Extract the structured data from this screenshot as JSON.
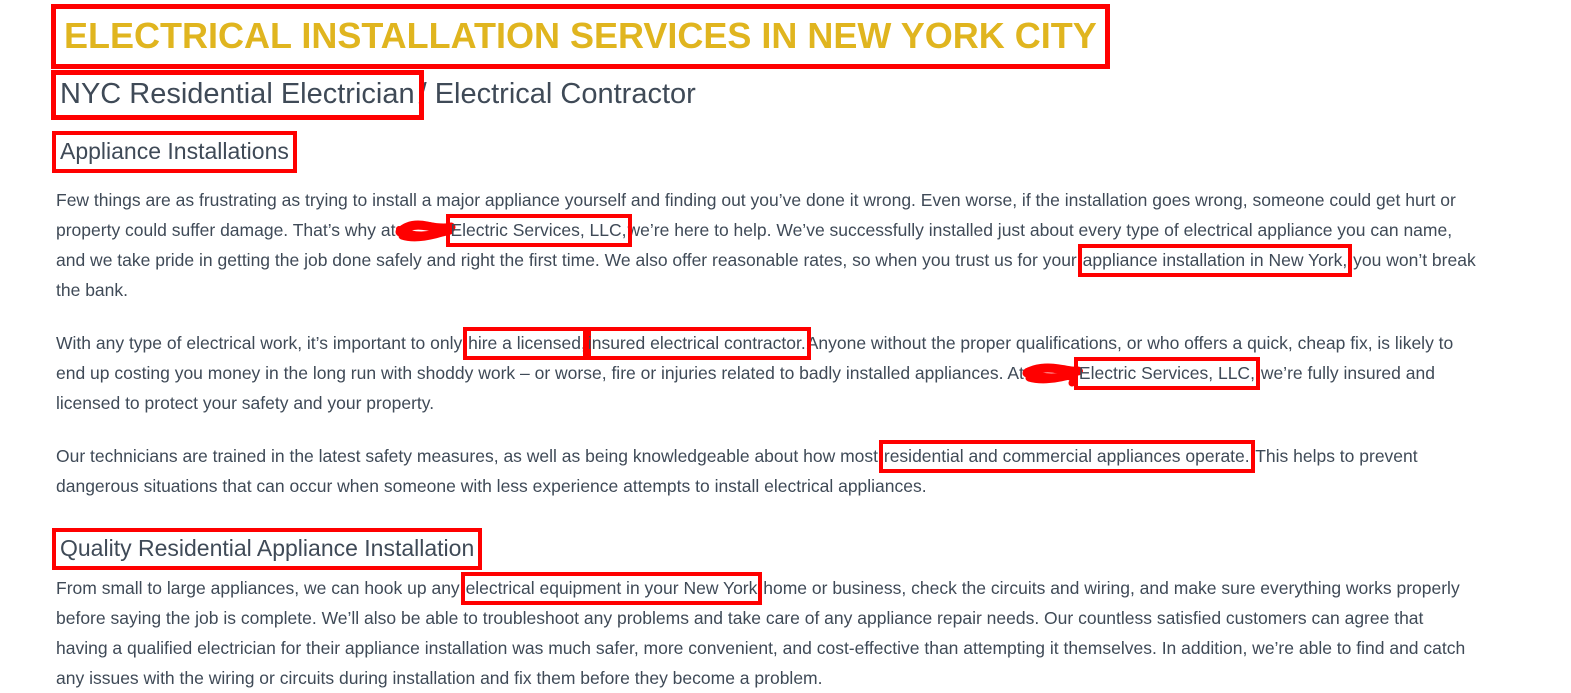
{
  "document": {
    "title": "ELECTRICAL INSTALLATION SERVICES IN NEW YORK CITY",
    "subtitle_highlighted": "NYC Residential Electrician",
    "subtitle_rest": "/ Electrical Contractor",
    "heading_1": "Appliance Installations",
    "heading_2": "Quality Residential Appliance Installation"
  },
  "colors": {
    "title_gold": "#e0b51f",
    "body_text": "#3f4a57",
    "annotation_red": "#ff0000"
  },
  "paragraph_1": {
    "seg_a": "Few things are as frustrating as trying to install a major appliance yourself and finding out you’ve done it wrong. Even worse, if the installation goes wrong, someone could get hurt or property could suffer damage. That’s why at",
    "redaction": "redacted-company-name",
    "seg_b_highlighted": "Electric Services, LLC,",
    "seg_c": "we’re here to help. We’ve successfully installed just about every type of electrical appliance you can name, and we take pride in getting the job done safely and right the first time. We also offer reasonable rates, so when you trust us for your",
    "seg_d_highlighted": "appliance installation in New York,",
    "seg_e": "you won’t break the bank."
  },
  "paragraph_2": {
    "seg_a": "With any type of electrical work, it’s important to only",
    "seg_b_highlighted": "hire a licensed,",
    "seg_c_highlighted": "insured electrical contractor.",
    "seg_d": "Anyone without the proper qualifications, or who offers a quick, cheap fix, is likely to end up costing you money in the long run with shoddy work – or worse, fire or injuries related to badly installed appliances. At",
    "redaction": "redacted-company-name",
    "seg_e_highlighted": "Electric Services, LLC,",
    "seg_f": "we’re fully insured and licensed to protect your safety and your property."
  },
  "paragraph_3": {
    "seg_a": "Our technicians are trained in the latest safety measures, as well as being knowledgeable about how most",
    "seg_b_highlighted": "residential and commercial appliances operate.",
    "seg_c": "This helps to prevent dangerous situations that can occur when someone with less experience attempts to install electrical appliances."
  },
  "paragraph_4": {
    "seg_a": "From small to large appliances, we can hook up any",
    "seg_b_highlighted": "electrical equipment in your New York",
    "seg_c": "home or business, check the circuits and wiring, and make sure everything works properly before saying the job is complete. We’ll also be able to troubleshoot any problems and take care of any appliance repair needs. Our countless satisfied customers can agree that having a qualified electrician for their appliance installation was much safer, more convenient, and cost-effective than attempting it themselves. In addition, we’re able to find and catch any issues with the wiring or circuits during installation and fix them before they become a problem."
  }
}
